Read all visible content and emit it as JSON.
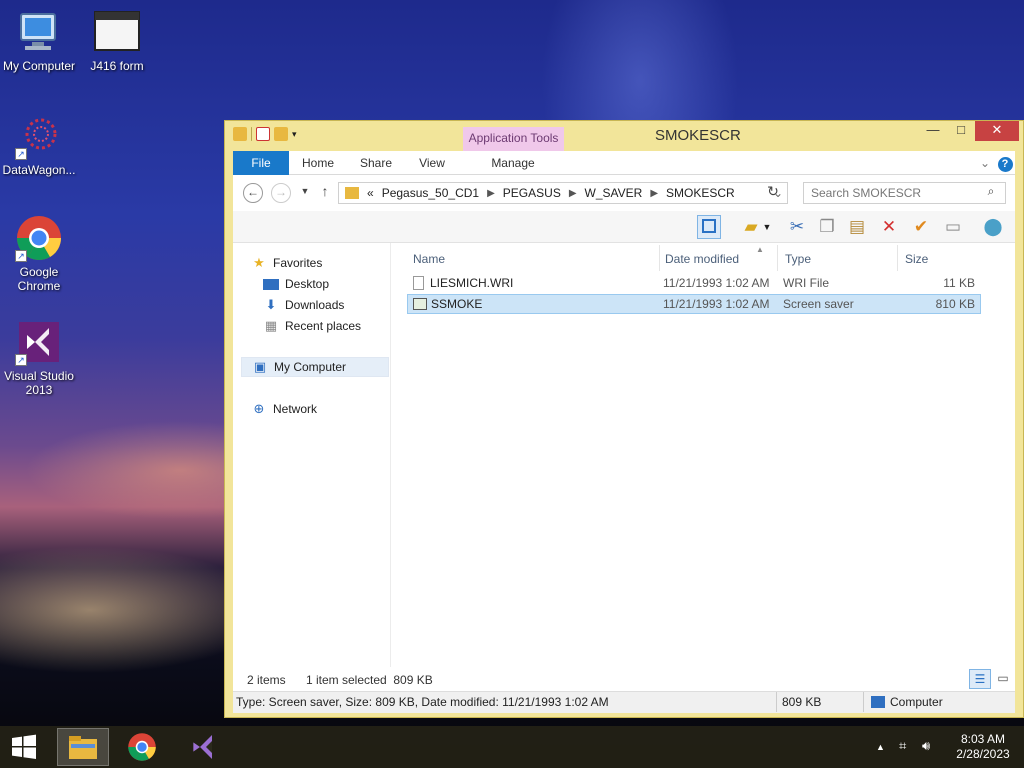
{
  "desktop": {
    "icons": [
      {
        "label": "My Computer",
        "icon": "computer-icon"
      },
      {
        "label": "J416 form",
        "icon": "window-icon"
      },
      {
        "label": "DataWagon...",
        "icon": "datawagon-icon"
      },
      {
        "label": "Google Chrome",
        "icon": "chrome-icon"
      },
      {
        "label": "Visual Studio 2013",
        "icon": "visual-studio-icon"
      }
    ]
  },
  "window": {
    "title": "SMOKESCR",
    "context_tab": "Application Tools",
    "ribbon_tabs": [
      "File",
      "Home",
      "Share",
      "View",
      "Manage"
    ],
    "breadcrumb": {
      "overflow": "«",
      "items": [
        "Pegasus_50_CD1",
        "PEGASUS",
        "W_SAVER",
        "SMOKESCR"
      ]
    },
    "search_placeholder": "Search SMOKESCR",
    "nav": {
      "favorites": "Favorites",
      "items": [
        "Desktop",
        "Downloads",
        "Recent places"
      ],
      "my_computer": "My Computer",
      "network": "Network"
    },
    "columns": [
      "Name",
      "Date modified",
      "Type",
      "Size"
    ],
    "files": [
      {
        "name": "LIESMICH.WRI",
        "date": "11/21/1993 1:02 AM",
        "type": "WRI File",
        "size": "11 KB",
        "selected": false
      },
      {
        "name": "SSMOKE",
        "date": "11/21/1993 1:02 AM",
        "type": "Screen saver",
        "size": "810 KB",
        "selected": true
      }
    ],
    "status": {
      "items": "2 items",
      "selection": "1 item selected  809 KB"
    },
    "details": {
      "summary": "Type: Screen saver, Size: 809 KB, Date modified: 11/21/1993 1:02 AM",
      "size": "809 KB",
      "location": "Computer"
    }
  },
  "taskbar": {
    "time": "8:03 AM",
    "date": "2/28/2023"
  },
  "colors": {
    "accent": "#1979ca",
    "window_frame": "#f2e59a",
    "selection": "#cce4f7",
    "close": "#c74242"
  }
}
